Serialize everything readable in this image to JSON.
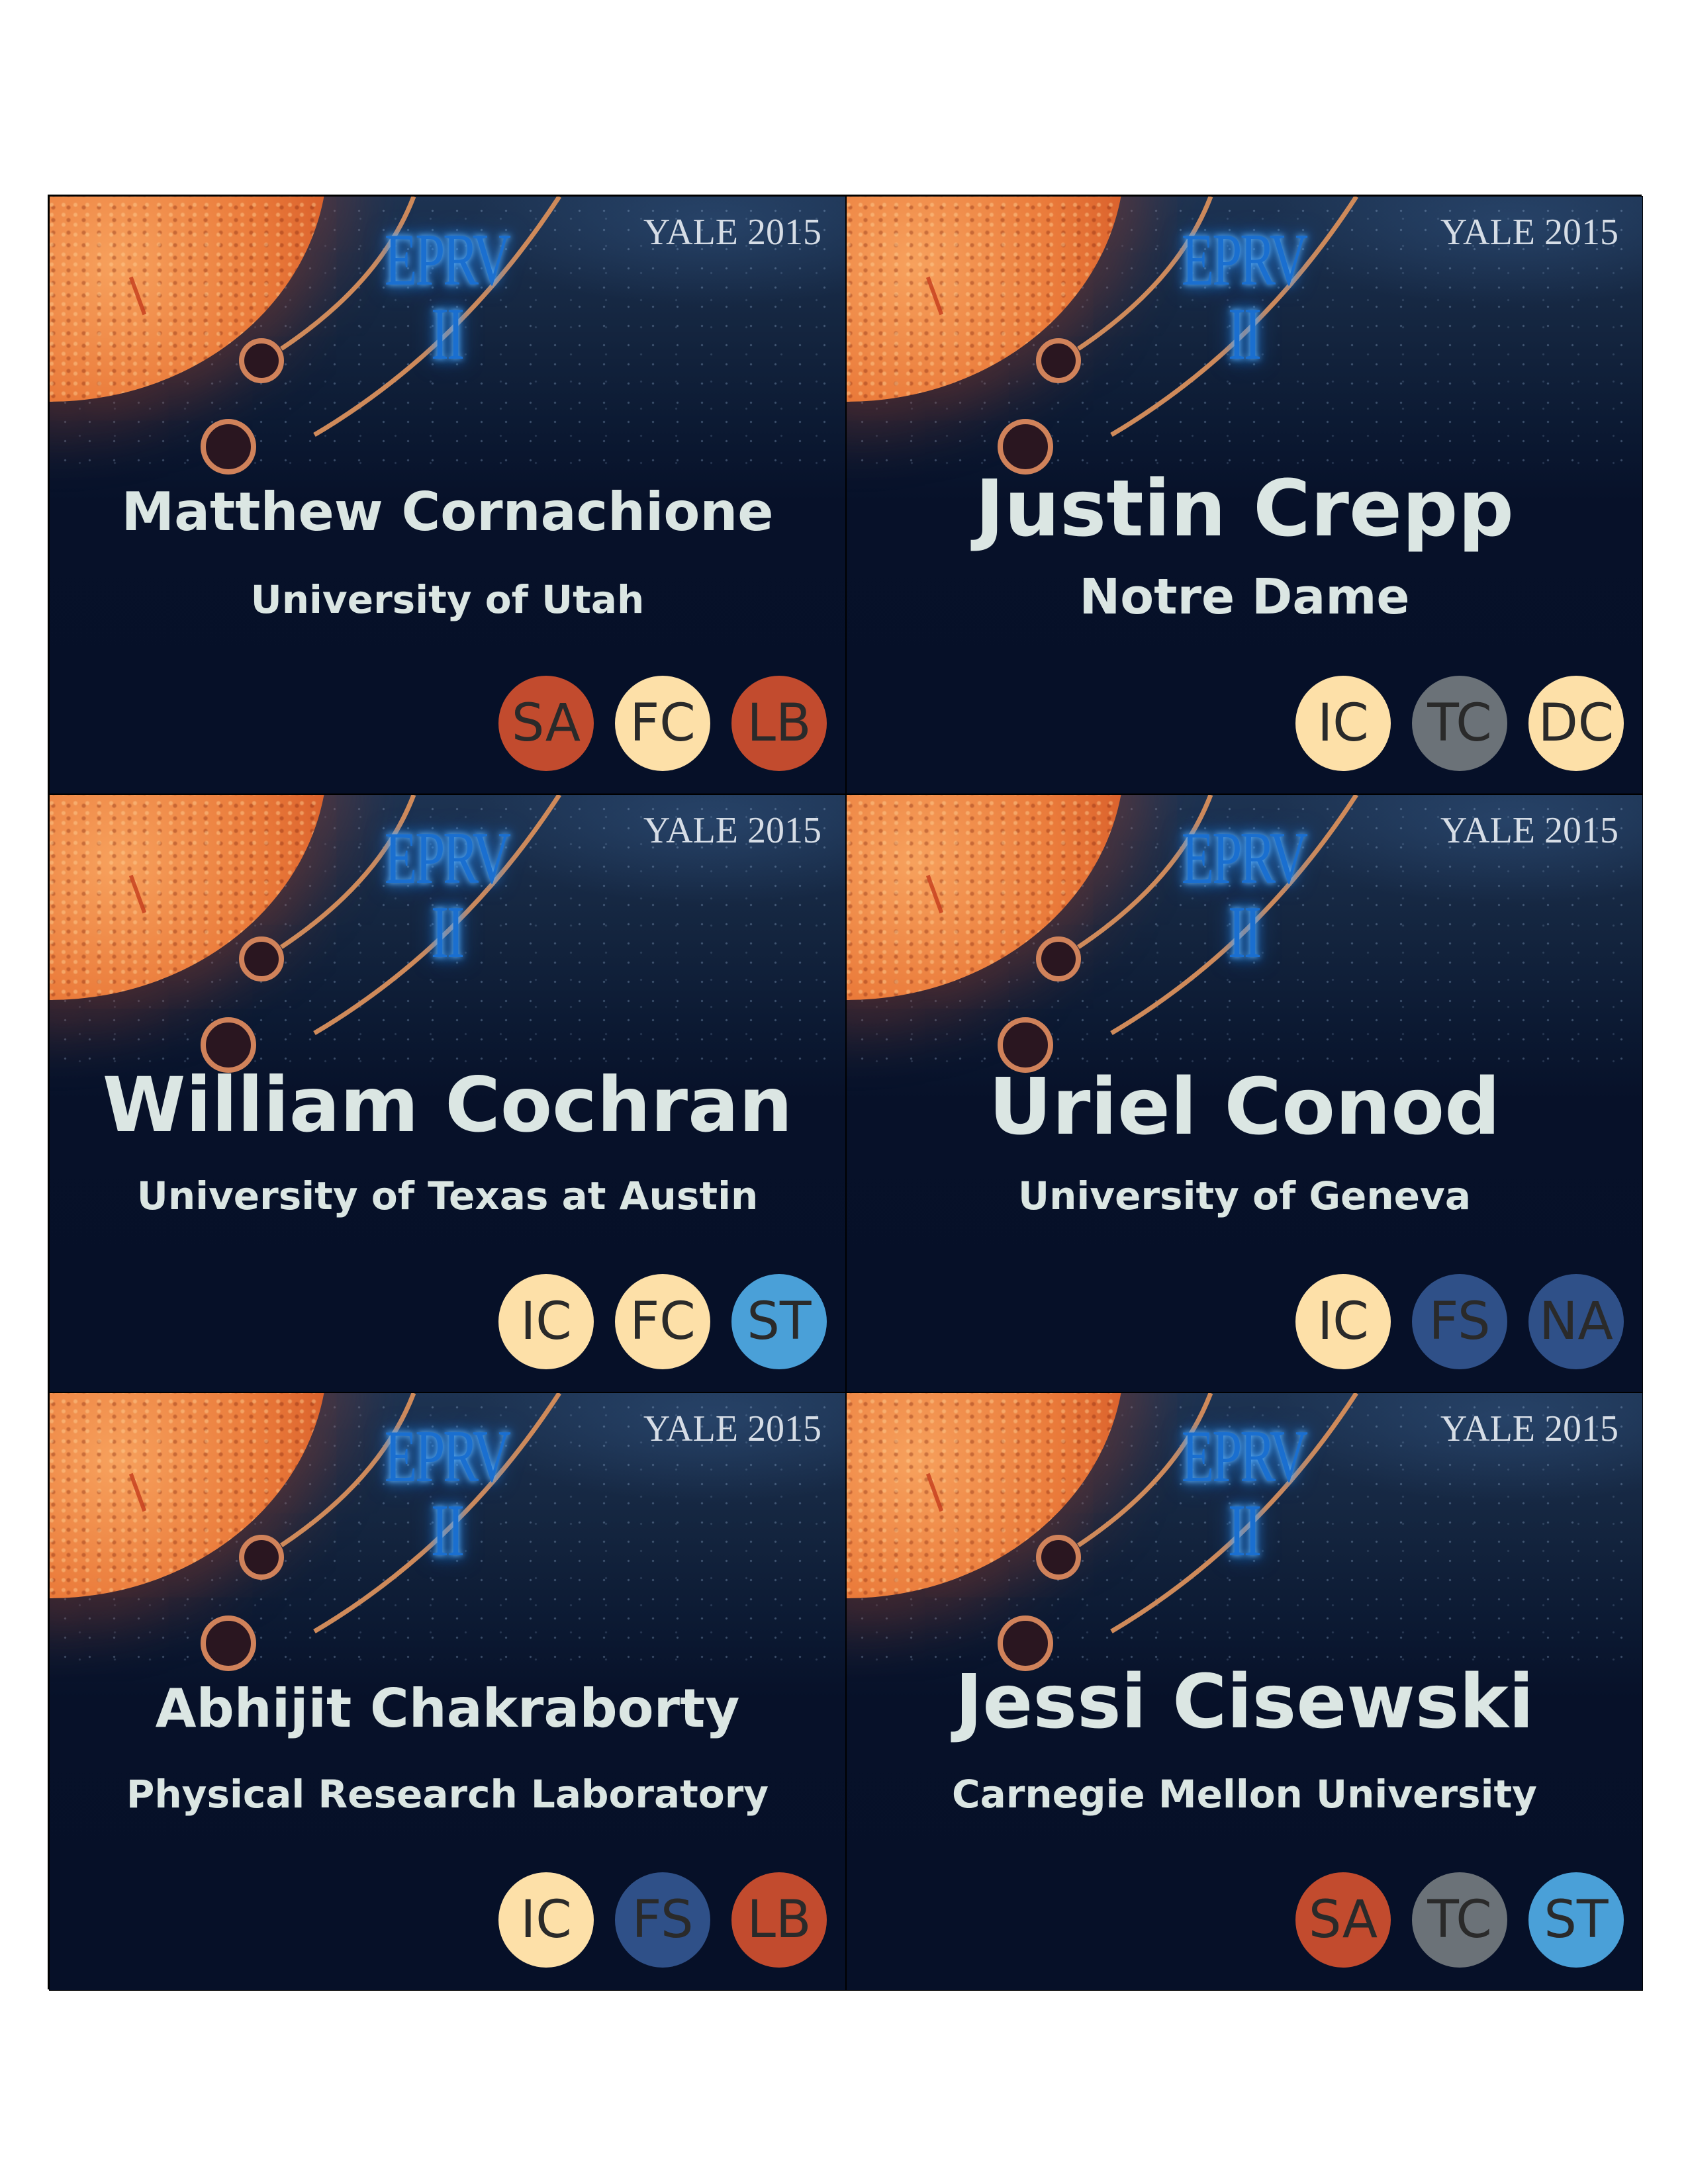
{
  "event": {
    "logo": "EPRV II",
    "label": "YALE 2015"
  },
  "badges": [
    {
      "name": "Matthew Cornachione",
      "affiliation": "University of Utah",
      "tags": [
        {
          "code": "SA",
          "color": "#c24b2e"
        },
        {
          "code": "FC",
          "color": "#fde0a8"
        },
        {
          "code": "LB",
          "color": "#c24b2e"
        }
      ]
    },
    {
      "name": "Justin Crepp",
      "affiliation": "Notre Dame",
      "tags": [
        {
          "code": "IC",
          "color": "#fde0a8"
        },
        {
          "code": "TC",
          "color": "#6b7278"
        },
        {
          "code": "DC",
          "color": "#fde0a8"
        }
      ]
    },
    {
      "name": "William Cochran",
      "affiliation": "University of Texas at Austin",
      "tags": [
        {
          "code": "IC",
          "color": "#fde0a8"
        },
        {
          "code": "FC",
          "color": "#fde0a8"
        },
        {
          "code": "ST",
          "color": "#4aa0d8"
        }
      ]
    },
    {
      "name": "Uriel Conod",
      "affiliation": "University of Geneva",
      "tags": [
        {
          "code": "IC",
          "color": "#fde0a8"
        },
        {
          "code": "FS",
          "color": "#2f5088"
        },
        {
          "code": "NA",
          "color": "#2f5088"
        }
      ]
    },
    {
      "name": "Abhijit Chakraborty",
      "affiliation": "Physical Research Laboratory",
      "tags": [
        {
          "code": "IC",
          "color": "#fde0a8"
        },
        {
          "code": "FS",
          "color": "#2f5088"
        },
        {
          "code": "LB",
          "color": "#c24b2e"
        }
      ]
    },
    {
      "name": "Jessi Cisewski",
      "affiliation": "Carnegie Mellon University",
      "tags": [
        {
          "code": "SA",
          "color": "#c24b2e"
        },
        {
          "code": "TC",
          "color": "#6b7278"
        },
        {
          "code": "ST",
          "color": "#4aa0d8"
        }
      ]
    }
  ]
}
